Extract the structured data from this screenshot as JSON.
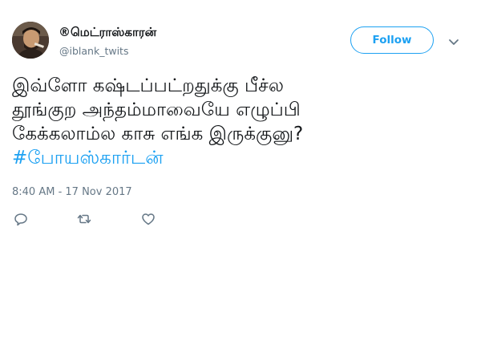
{
  "author": {
    "display_name": "®மெட்ராஸ்காரன்",
    "handle": "@iblank_twits"
  },
  "follow_label": "Follow",
  "tweet": {
    "lines": [
      "இவ்ளோ கஷ்டப்பட்றதுக்கு பீச்ல",
      "தூங்குற அந்தம்மாவையே எழுப்பி",
      "கேக்கலாம்ல காசு எங்க இருக்குனு?"
    ],
    "hashtag": "#போயஸ்கார்டன்"
  },
  "timestamp": "8:40 AM - 17 Nov 2017",
  "actions": [
    "reply-icon",
    "retweet-icon",
    "like-icon"
  ],
  "colors": {
    "accent": "#1da1f2",
    "text": "#14171a",
    "muted": "#657786"
  }
}
